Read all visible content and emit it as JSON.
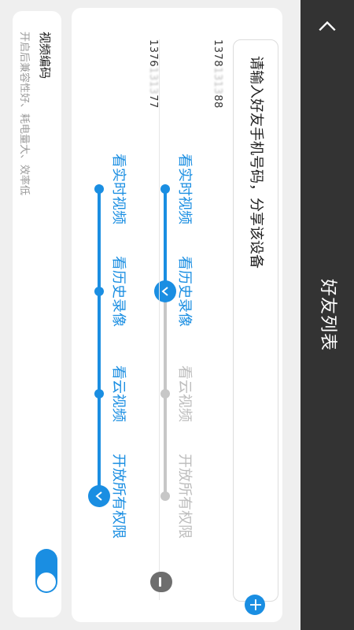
{
  "header": {
    "title": "好友列表"
  },
  "share": {
    "placeholder": "请输入好友手机号码，分享该设备"
  },
  "friends": [
    {
      "phone_prefix": "1378",
      "phone_masked": "1313",
      "phone_suffix": "88",
      "labels": [
        "看实时视频",
        "看历史录像",
        "看云视频",
        "开放所有权限"
      ],
      "enabled": [
        true,
        true,
        false,
        false
      ],
      "level": 2
    },
    {
      "phone_prefix": "1376",
      "phone_masked": "1313",
      "phone_suffix": "77",
      "labels": [
        "看实时视频",
        "看历史录像",
        "看云视频",
        "开放所有权限"
      ],
      "enabled": [
        true,
        true,
        true,
        true
      ],
      "level": 4
    }
  ],
  "video_encoding": {
    "title": "视频编码",
    "description": "开启后兼容性好、耗电量大、效率低",
    "enabled": true
  },
  "colors": {
    "accent": "#1a8ee2",
    "header": "#333333",
    "disabled": "#bdbdbd"
  }
}
